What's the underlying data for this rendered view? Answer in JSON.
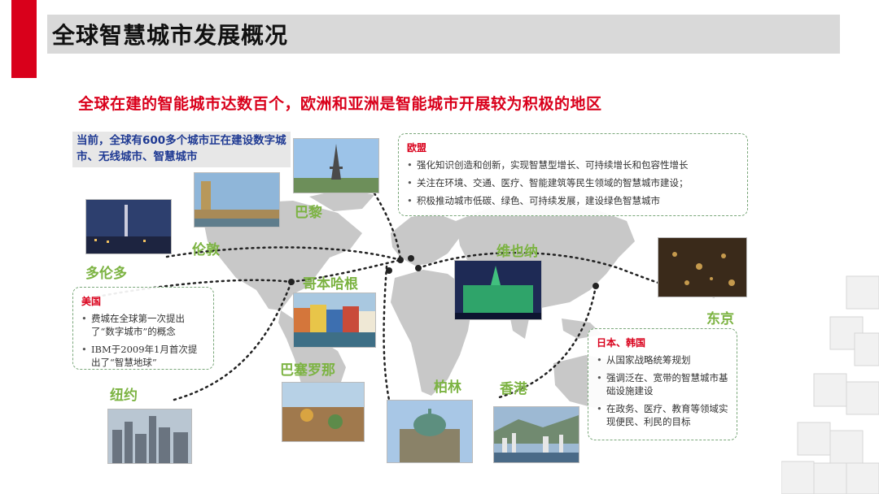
{
  "slide": {
    "title": "全球智慧城市发展概况",
    "headline": "全球在建的智能城市达数百个，欧洲和亚洲是智能城市开展较为积极的地区",
    "note": "当前，全球有600多个城市正在建设数字城市、无线城市、智慧城市"
  },
  "cities": {
    "paris": "巴黎",
    "london": "伦敦",
    "toronto": "多伦多",
    "copenhagen": "哥本哈根",
    "vienna": "维也纳",
    "tokyo": "东京",
    "barcelona": "巴塞罗那",
    "newyork": "纽约",
    "berlin": "柏林",
    "hongkong": "香港"
  },
  "boxes": {
    "europe": {
      "title": "欧盟",
      "items": [
        "强化知识创造和创新，实现智慧型增长、可持续增长和包容性增长",
        "关注在环境、交通、医疗、智能建筑等民生领域的智慧城市建设；",
        "积极推动城市低碳、绿色、可持续发展，建设绿色智慧城市"
      ]
    },
    "usa": {
      "title": "美国",
      "items": [
        "费城在全球第一次提出了“数字城市”的概念",
        "IBM于2009年1月首次提出了“智慧地球”"
      ]
    },
    "japan_korea": {
      "title": "日本、韩国",
      "items": [
        "从国家战略统筹规划",
        "强调泛在、宽带的智慧城市基础设施建设",
        "在政务、医疗、教育等领域实现便民、利民的目标"
      ]
    }
  },
  "colors": {
    "accent": "#d9001b",
    "city_label": "#7cb342",
    "note_text": "#1f3a93"
  }
}
